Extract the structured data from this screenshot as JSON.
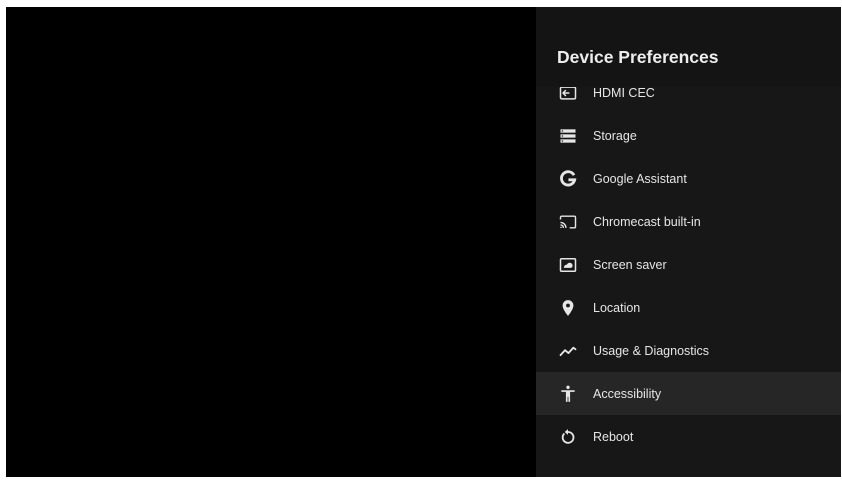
{
  "panel": {
    "title": "Device Preferences",
    "focused_index": 7,
    "items": [
      {
        "label": "HDMI CEC",
        "icon": "input-icon"
      },
      {
        "label": "Storage",
        "icon": "storage-icon"
      },
      {
        "label": "Google Assistant",
        "icon": "google-icon"
      },
      {
        "label": "Chromecast built-in",
        "icon": "cast-icon"
      },
      {
        "label": "Screen saver",
        "icon": "screensaver-icon"
      },
      {
        "label": "Location",
        "icon": "location-pin-icon"
      },
      {
        "label": "Usage & Diagnostics",
        "icon": "trending-line-icon"
      },
      {
        "label": "Accessibility",
        "icon": "accessibility-icon"
      },
      {
        "label": "Reboot",
        "icon": "reboot-icon"
      }
    ]
  },
  "colors": {
    "screen_background": "#000000",
    "panel_background": "#171717",
    "focused_row": "#262626",
    "text": "#e6e6e6",
    "title_text": "#ededed"
  }
}
